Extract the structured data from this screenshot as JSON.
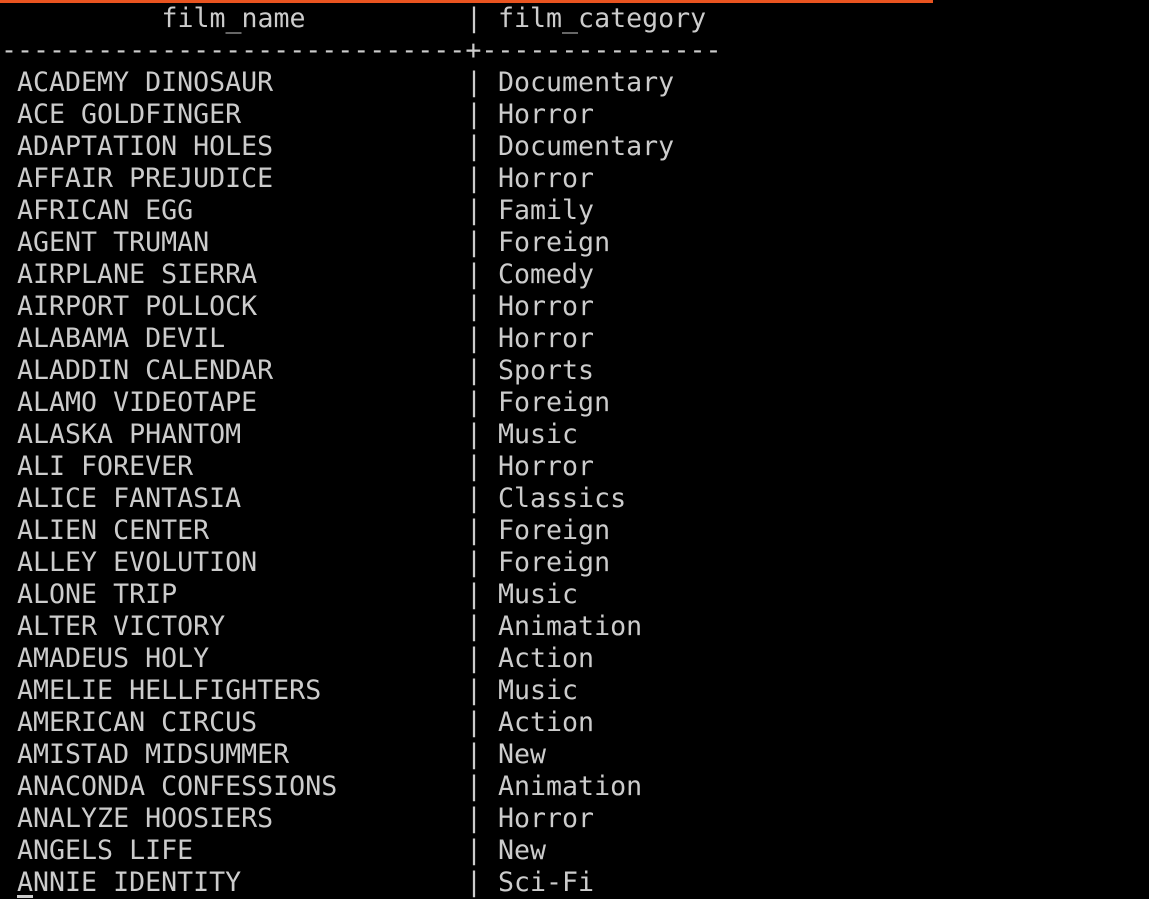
{
  "colors": {
    "background": "#000000",
    "text": "#cccccc",
    "accent": "#e95420"
  },
  "table": {
    "headers": [
      "film_name",
      "film_category"
    ],
    "column_separator": "|",
    "divider": "-----------------------------+---------------",
    "rows": [
      [
        "ACADEMY DINOSAUR",
        "Documentary"
      ],
      [
        "ACE GOLDFINGER",
        "Horror"
      ],
      [
        "ADAPTATION HOLES",
        "Documentary"
      ],
      [
        "AFFAIR PREJUDICE",
        "Horror"
      ],
      [
        "AFRICAN EGG",
        "Family"
      ],
      [
        "AGENT TRUMAN",
        "Foreign"
      ],
      [
        "AIRPLANE SIERRA",
        "Comedy"
      ],
      [
        "AIRPORT POLLOCK",
        "Horror"
      ],
      [
        "ALABAMA DEVIL",
        "Horror"
      ],
      [
        "ALADDIN CALENDAR",
        "Sports"
      ],
      [
        "ALAMO VIDEOTAPE",
        "Foreign"
      ],
      [
        "ALASKA PHANTOM",
        "Music"
      ],
      [
        "ALI FOREVER",
        "Horror"
      ],
      [
        "ALICE FANTASIA",
        "Classics"
      ],
      [
        "ALIEN CENTER",
        "Foreign"
      ],
      [
        "ALLEY EVOLUTION",
        "Foreign"
      ],
      [
        "ALONE TRIP",
        "Music"
      ],
      [
        "ALTER VICTORY",
        "Animation"
      ],
      [
        "AMADEUS HOLY",
        "Action"
      ],
      [
        "AMELIE HELLFIGHTERS",
        "Music"
      ],
      [
        "AMERICAN CIRCUS",
        "Action"
      ],
      [
        "AMISTAD MIDSUMMER",
        "New"
      ],
      [
        "ANACONDA CONFESSIONS",
        "Animation"
      ],
      [
        "ANALYZE HOOSIERS",
        "Horror"
      ],
      [
        "ANGELS LIFE",
        "New"
      ],
      [
        "ANNIE IDENTITY",
        "Sci-Fi"
      ]
    ]
  }
}
